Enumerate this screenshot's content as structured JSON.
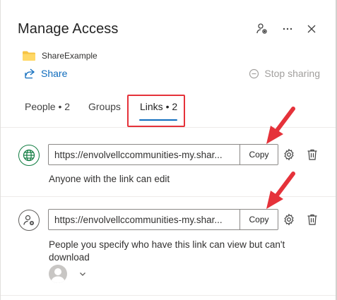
{
  "header": {
    "title": "Manage Access"
  },
  "file": {
    "name": "ShareExample"
  },
  "actions": {
    "share_label": "Share",
    "stop_sharing_label": "Stop sharing"
  },
  "tabs": [
    {
      "label": "People • 2"
    },
    {
      "label": "Groups"
    },
    {
      "label": "Links • 2"
    }
  ],
  "links": [
    {
      "url": "https://envolvellccommunities-my.shar...",
      "copy_label": "Copy",
      "description": "Anyone with the link can edit"
    },
    {
      "url": "https://envolvellccommunities-my.shar...",
      "copy_label": "Copy",
      "description": "People you specify who have this link can view but can't download"
    }
  ],
  "colors": {
    "accent": "#0f6cbd",
    "highlight": "#e5323a",
    "folder": "#f6c343",
    "globe": "#107c41"
  },
  "icons": {
    "header": [
      "person-gear-icon",
      "more-icon",
      "close-icon"
    ],
    "file": "folder-icon",
    "share": "share-icon",
    "stop": "stop-sharing-icon",
    "link1": "globe-icon",
    "link2": "person-add-icon",
    "row": [
      "settings-icon",
      "delete-icon"
    ]
  }
}
